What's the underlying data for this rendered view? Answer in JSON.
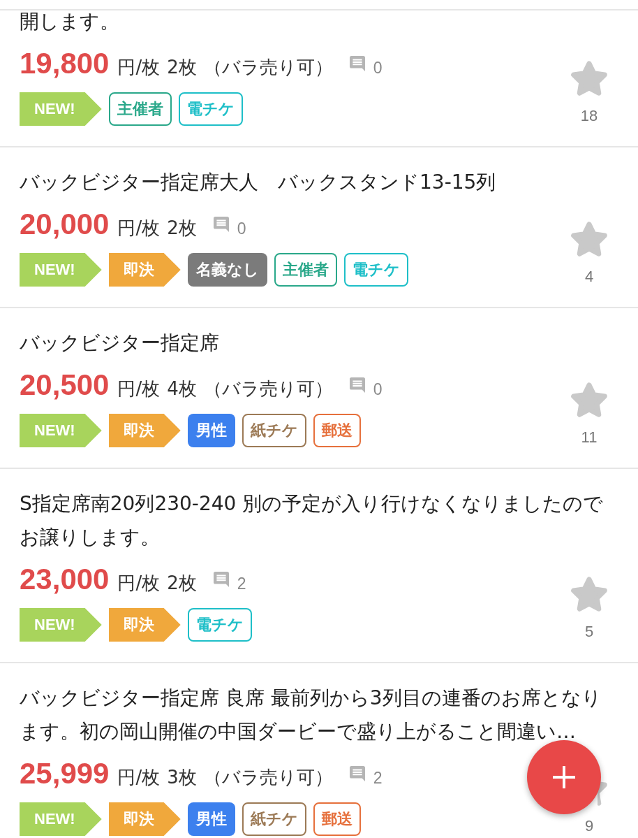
{
  "listings": [
    {
      "title_lines": [
        "開します。"
      ],
      "price": "19,800",
      "unit": "円/枚",
      "quantity": "2枚",
      "split_sale": "（バラ売り可）",
      "comments": "0",
      "tags": [
        {
          "kind": "arrow",
          "label": "NEW!",
          "color": "#a8d45c"
        },
        {
          "kind": "outline",
          "label": "主催者",
          "color": "#2aa88a"
        },
        {
          "kind": "outline",
          "label": "電チケ",
          "color": "#1ebfc8"
        }
      ],
      "favorited": false,
      "favorites": "18"
    },
    {
      "title_lines": [
        "バックビジター指定席大人　バックスタンド13-15列"
      ],
      "price": "20,000",
      "unit": "円/枚",
      "quantity": "2枚",
      "comments": "0",
      "tags": [
        {
          "kind": "arrow",
          "label": "NEW!",
          "color": "#a8d45c"
        },
        {
          "kind": "arrow",
          "label": "即決",
          "color": "#f0a83c"
        },
        {
          "kind": "filled",
          "label": "名義なし",
          "color": "#7b7b7b"
        },
        {
          "kind": "outline",
          "label": "主催者",
          "color": "#2aa88a"
        },
        {
          "kind": "outline",
          "label": "電チケ",
          "color": "#1ebfc8"
        }
      ],
      "favorited": false,
      "favorites": "4"
    },
    {
      "title_lines": [
        "バックビジター指定席"
      ],
      "price": "20,500",
      "unit": "円/枚",
      "quantity": "4枚",
      "split_sale": "（バラ売り可）",
      "comments": "0",
      "tags": [
        {
          "kind": "arrow",
          "label": "NEW!",
          "color": "#a8d45c"
        },
        {
          "kind": "arrow",
          "label": "即決",
          "color": "#f0a83c"
        },
        {
          "kind": "filled",
          "label": "男性",
          "color": "#3c80ee"
        },
        {
          "kind": "outline",
          "label": "紙チケ",
          "color": "#9c7a56"
        },
        {
          "kind": "outline",
          "label": "郵送",
          "color": "#e6703c"
        }
      ],
      "favorited": false,
      "favorites": "11"
    },
    {
      "title_lines": [
        "S指定席南20列230-240 別の予定が入り行けなくなりましたので",
        "お譲りします。"
      ],
      "price": "23,000",
      "unit": "円/枚",
      "quantity": "2枚",
      "comments": "2",
      "tags": [
        {
          "kind": "arrow",
          "label": "NEW!",
          "color": "#a8d45c"
        },
        {
          "kind": "arrow",
          "label": "即決",
          "color": "#f0a83c"
        },
        {
          "kind": "outline",
          "label": "電チケ",
          "color": "#1ebfc8"
        }
      ],
      "favorited": false,
      "favorites": "5"
    },
    {
      "title_lines": [
        "バックビジター指定席 良席 最前列から3列目の連番のお席となり",
        "ます。初の岡山開催の中国ダービーで盛り上がること間違い…"
      ],
      "price": "25,999",
      "unit": "円/枚",
      "quantity": "3枚",
      "split_sale": "（バラ売り可）",
      "comments": "2",
      "tags": [
        {
          "kind": "arrow",
          "label": "NEW!",
          "color": "#a8d45c"
        },
        {
          "kind": "arrow",
          "label": "即決",
          "color": "#f0a83c"
        },
        {
          "kind": "filled",
          "label": "男性",
          "color": "#3c80ee"
        },
        {
          "kind": "outline",
          "label": "紙チケ",
          "color": "#9c7a56"
        },
        {
          "kind": "outline",
          "label": "郵送",
          "color": "#e6703c"
        }
      ],
      "favorited": false,
      "favorites": "9"
    }
  ]
}
